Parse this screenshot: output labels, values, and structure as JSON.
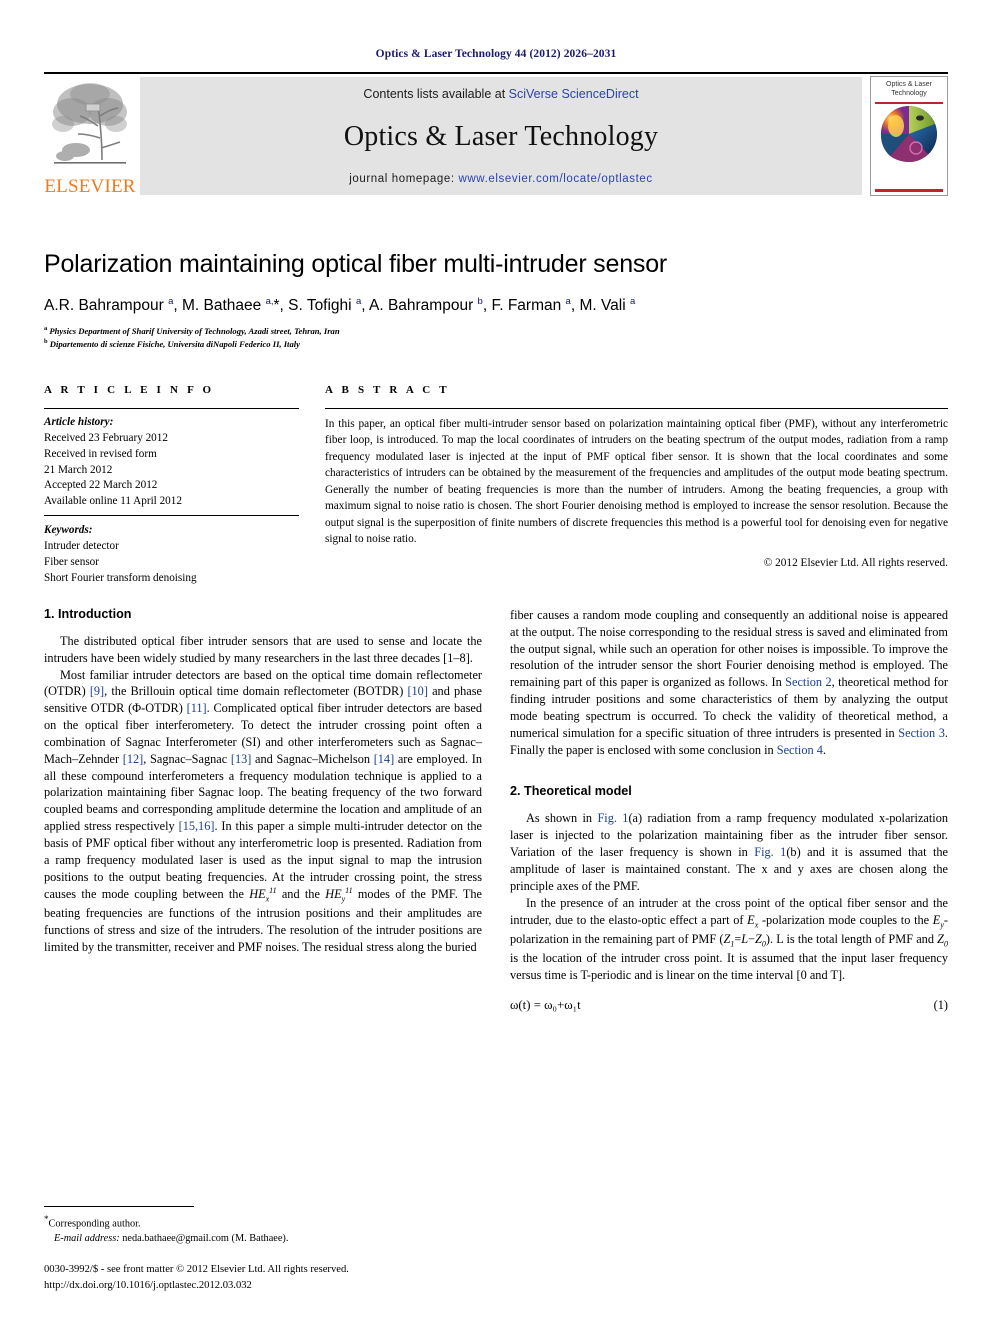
{
  "running_head": "Optics & Laser Technology 44 (2012) 2026–2031",
  "banner": {
    "publisher_name": "ELSEVIER",
    "contents_prefix": "Contents lists available at ",
    "contents_link": "SciVerse ScienceDirect",
    "journal_title": "Optics & Laser Technology",
    "homepage_prefix": "journal homepage: ",
    "homepage_url": "www.elsevier.com/locate/optlastec",
    "cover_title": "Optics & Laser Technology"
  },
  "article": {
    "title": "Polarization maintaining optical fiber multi-intruder sensor",
    "authors_html": "A.R. Bahrampour <sup>a</sup>, M. Bathaee <sup>a,</sup>*, S. Tofighi <sup>a</sup>, A. Bahrampour <sup>b</sup>, F. Farman <sup>a</sup>, M. Vali <sup>a</sup>",
    "affiliation_a": "Physics Department of Sharif University of Technology, Azadi street, Tehran, Iran",
    "affiliation_b": "Dipartemento di scienze Fisiche, Universita diNapoli Federico II, Italy"
  },
  "article_info": {
    "heading": "A R T I C L E  I N F O",
    "history_label": "Article history:",
    "history": [
      "Received 23 February 2012",
      "Received in revised form",
      "21 March 2012",
      "Accepted 22 March 2012",
      "Available online 11 April 2012"
    ],
    "keywords_label": "Keywords:",
    "keywords": [
      "Intruder detector",
      "Fiber sensor",
      "Short Fourier transform denoising"
    ]
  },
  "abstract": {
    "heading": "A B S T R A C T",
    "text": "In this paper, an optical fiber multi-intruder sensor based on polarization maintaining optical fiber (PMF), without any interferometric fiber loop, is introduced. To map the local coordinates of intruders on the beating spectrum of the output modes, radiation from a ramp frequency modulated laser is injected at the input of PMF optical fiber sensor. It is shown that the local coordinates and some characteristics of intruders can be obtained by the measurement of the frequencies and amplitudes of the output mode beating spectrum. Generally the number of beating frequencies is more than the number of intruders. Among the beating frequencies, a group with maximum signal to noise ratio is chosen. The short Fourier denoising method is employed to increase the sensor resolution. Because the output signal is the superposition of finite numbers of discrete frequencies this method is a powerful tool for denoising even for negative signal to noise ratio.",
    "copyright": "© 2012 Elsevier Ltd. All rights reserved."
  },
  "sections": {
    "intro_heading": "1.  Introduction",
    "intro_p1": "The distributed optical fiber intruder sensors that are used to sense and locate the intruders have been widely studied by many researchers in the last three decades [1–8].",
    "intro_p2_a": "Most familiar intruder detectors are based on the optical time domain reflectometer (OTDR) ",
    "intro_p2_ref9": "[9]",
    "intro_p2_b": ", the Brillouin optical time domain reflectometer (BOTDR) ",
    "intro_p2_ref10": "[10]",
    "intro_p2_c": " and phase sensitive OTDR (Φ-OTDR) ",
    "intro_p2_ref11": "[11]",
    "intro_p2_d": ". Complicated optical fiber intruder detectors are based on the optical fiber interferometery. To detect the intruder crossing point often a combination of Sagnac Interferometer (SI) and other interferometers such as Sagnac–Mach–Zehnder ",
    "intro_p2_ref12": "[12]",
    "intro_p2_e": ", Sagnac–Sagnac ",
    "intro_p2_ref13": "[13]",
    "intro_p2_f": " and Sagnac–Michelson ",
    "intro_p2_ref14": "[14]",
    "intro_p2_g": " are employed. In all these compound interferometers a frequency modulation technique is applied to a polarization maintaining fiber Sagnac loop. The beating frequency of the two forward coupled beams and corresponding amplitude determine the location and amplitude of an applied stress respectively ",
    "intro_p2_ref1516": "[15,16]",
    "intro_p2_h": ". In this paper a simple multi-intruder detector on the basis of PMF optical fiber without any interferometric loop is presented. Radiation from a ramp frequency modulated laser is used as the input signal to map the intrusion positions to the output beating frequencies. At the intruder crossing point, the stress causes the mode coupling between the ",
    "intro_p2_i": " and the ",
    "intro_p2_j": " modes of the PMF. The beating frequencies are functions of the intrusion positions and their amplitudes are functions of stress and size of the intruders. The resolution of the intruder positions are limited by the transmitter, receiver and PMF noises. The residual stress along the buried",
    "right_p1_a": "fiber causes a random mode coupling and consequently an additional noise is appeared at the output. The noise corresponding to the residual stress is saved and eliminated from the output signal, while such an operation for other noises is impossible. To improve the resolution of the intruder sensor the short Fourier denoising method is employed. The remaining part of this paper is organized as follows. In ",
    "right_p1_sec2": "Section 2",
    "right_p1_b": ", theoretical method for finding intruder positions and some characteristics of them by analyzing the output mode beating spectrum is occurred. To check the validity of theoretical method, a numerical simulation for a specific situation of three intruders is presented in ",
    "right_p1_sec3": "Section 3",
    "right_p1_c": ". Finally the paper is enclosed with some conclusion in ",
    "right_p1_sec4": "Section 4",
    "right_p1_d": ".",
    "theory_heading": "2.  Theoretical model",
    "theory_p1_a": "As shown in ",
    "theory_p1_fig1a": "Fig. 1",
    "theory_p1_b": "(a) radiation from a ramp frequency modulated x-polarization laser is injected to the polarization maintaining fiber as the intruder fiber sensor. Variation of the laser frequency is shown in ",
    "theory_p1_fig1b": "Fig. 1",
    "theory_p1_c": "(b) and it is assumed that the amplitude of laser is maintained constant. The x and y axes are chosen along the principle axes of the PMF.",
    "theory_p2_a": "In the presence of an intruder at the cross point of the optical fiber sensor and the intruder, due to the elasto-optic effect a part of ",
    "theory_p2_b": " -polarization mode couples to the ",
    "theory_p2_c": "-polarization in the remaining part of PMF (",
    "theory_p2_d": "). L is the total length of PMF and ",
    "theory_p2_e": " is the location of the intruder cross point. It is assumed that the input laser frequency versus time is T-periodic and is linear on the time interval [0 and T].",
    "equation_1": "ω(t) = ω₀+ω₁t",
    "equation_1_number": "(1)"
  },
  "footnotes": {
    "corresponding": "Corresponding author.",
    "email_label": "E-mail address:",
    "email_value": " neda.bathaee@gmail.com (M. Bathaee).",
    "imprint_line1": "0030-3992/$ - see front matter © 2012 Elsevier Ltd. All rights reserved.",
    "imprint_line2": "http://dx.doi.org/10.1016/j.optlastec.2012.03.032"
  },
  "colors": {
    "link": "#2b43a8",
    "ref": "#1b3f8f",
    "running_head": "#1a1a6e",
    "elsevier_orange": "#F07B1D",
    "banner_bg": "#e3e3e3",
    "cover_red": "#c0242c"
  }
}
